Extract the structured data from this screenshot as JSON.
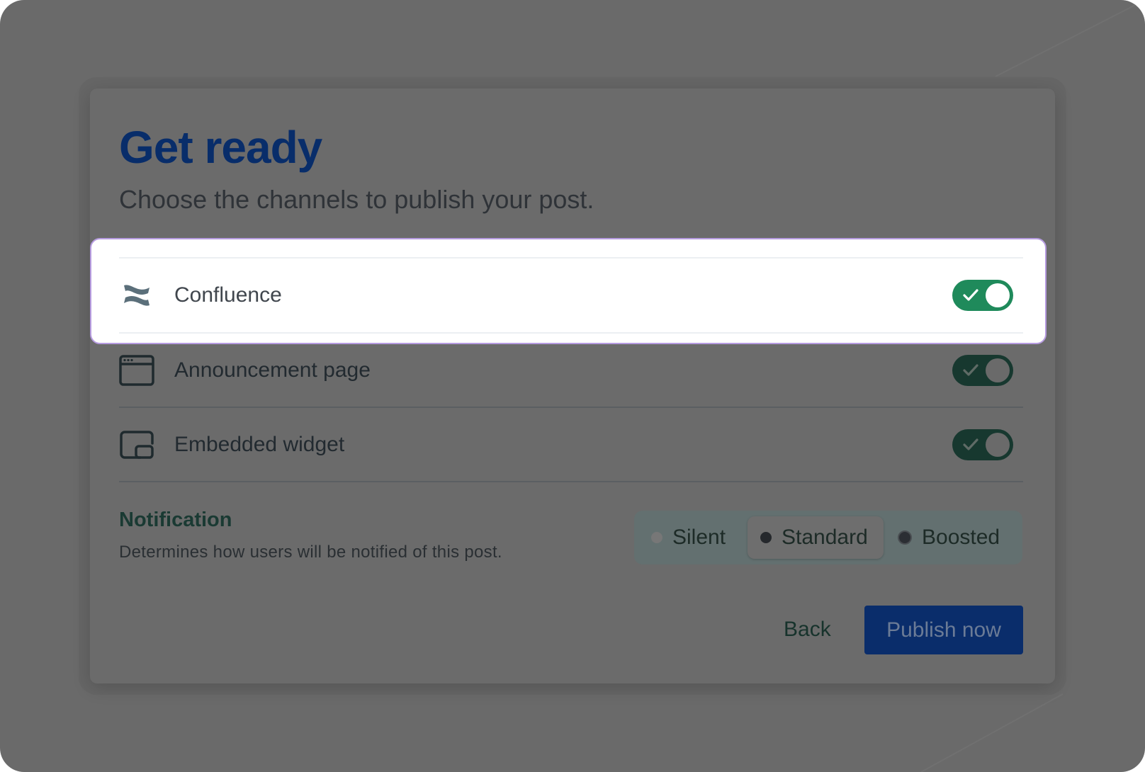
{
  "dialog": {
    "title": "Get ready",
    "subtitle": "Choose the channels to publish your post."
  },
  "channels": [
    {
      "label": "Confluence",
      "icon": "confluence-logo-icon",
      "enabled": true,
      "highlighted": true
    },
    {
      "label": "Announcement page",
      "icon": "browser-window-icon",
      "enabled": true,
      "highlighted": false
    },
    {
      "label": "Embedded widget",
      "icon": "embedded-widget-icon",
      "enabled": true,
      "highlighted": false
    }
  ],
  "notification": {
    "title": "Notification",
    "description": "Determines how users will be notified of this post.",
    "options": [
      "Silent",
      "Standard",
      "Boosted"
    ],
    "selected": "Standard"
  },
  "actions": {
    "back_label": "Back",
    "publish_label": "Publish now"
  },
  "colors": {
    "backdrop": "#6a6a6a",
    "title": "#082d6a",
    "toggle_on_active": "#1f8a5b",
    "toggle_on_dimmed": "#17382f",
    "highlight_border": "#b69be0",
    "primary_button": "#0a2d6b"
  }
}
